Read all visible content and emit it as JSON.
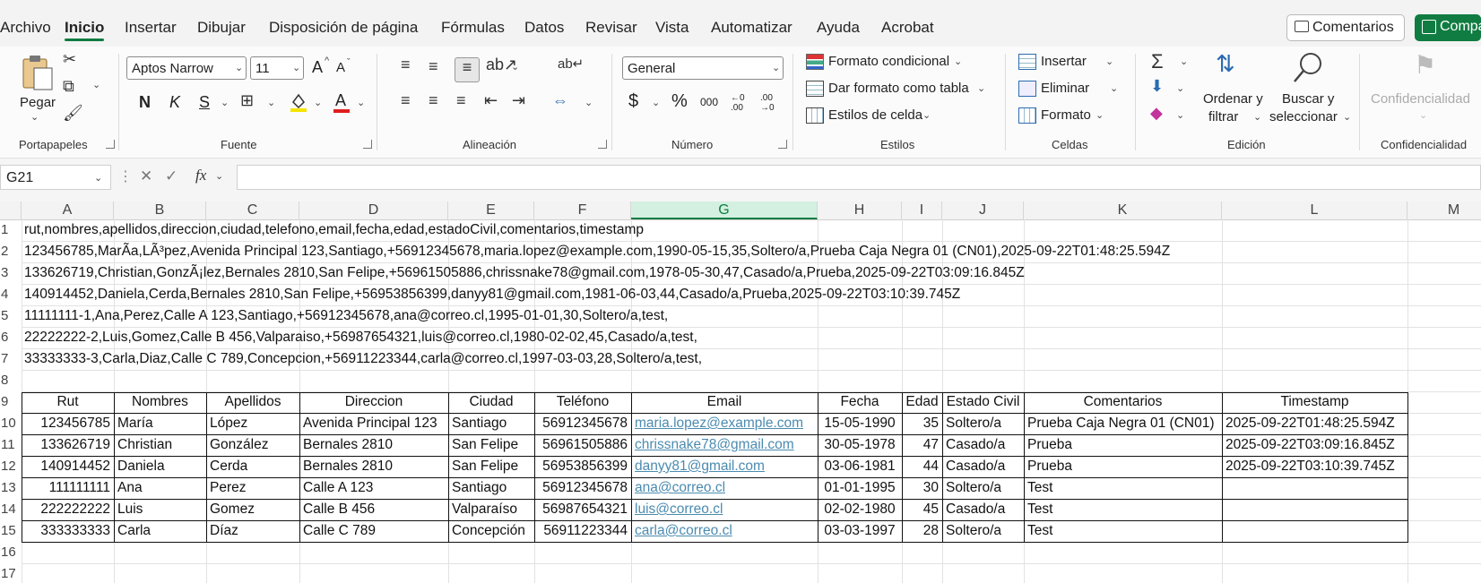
{
  "menu": {
    "tabs": [
      "Archivo",
      "Inicio",
      "Insertar",
      "Dibujar",
      "Disposición de página",
      "Fórmulas",
      "Datos",
      "Revisar",
      "Vista",
      "Automatizar",
      "Ayuda",
      "Acrobat"
    ],
    "comments_label": "Comentarios",
    "share_label": "Compartir"
  },
  "ribbon": {
    "portapapeles": {
      "label": "Portapapeles",
      "paste": "Pegar"
    },
    "fuente": {
      "label": "Fuente",
      "font_name": "Aptos Narrow",
      "font_size": "11",
      "bold": "N",
      "italic": "K",
      "underline": "S",
      "grow": "A",
      "shrink": "A"
    },
    "alineacion": {
      "label": "Alineación"
    },
    "numero": {
      "label": "Número",
      "format": "General",
      "currency": "$",
      "percent": "%",
      "thousands": "000",
      "inc_decimal": "←0 .00",
      "dec_decimal": ".00 →0"
    },
    "estilos": {
      "label": "Estilos",
      "conditional": "Formato condicional",
      "as_table": "Dar formato como tabla",
      "cell_styles": "Estilos de celda"
    },
    "celdas": {
      "label": "Celdas",
      "insert": "Insertar",
      "delete": "Eliminar",
      "format": "Formato"
    },
    "edicion": {
      "label": "Edición",
      "sort_l1": "Ordenar y",
      "sort_l2": "filtrar",
      "find_l1": "Buscar y",
      "find_l2": "seleccionar"
    },
    "confidencialidad": {
      "label": "Confidencialidad",
      "button": "Confidencialidad"
    }
  },
  "formula_bar": {
    "name_box": "G21",
    "fx": "fx",
    "formula": ""
  },
  "grid": {
    "columns": [
      "A",
      "B",
      "C",
      "D",
      "E",
      "F",
      "G",
      "H",
      "I",
      "J",
      "K",
      "L",
      "M"
    ],
    "rows": [
      "1",
      "2",
      "3",
      "4",
      "5",
      "6",
      "7",
      "8",
      "9",
      "10",
      "11",
      "12",
      "13",
      "14",
      "15",
      "16",
      "17"
    ],
    "csv_lines": [
      "rut,nombres,apellidos,direccion,ciudad,telefono,email,fecha,edad,estadoCivil,comentarios,timestamp",
      "123456785,MarÃ­a,LÃ³pez,Avenida Principal 123,Santiago,+56912345678,maria.lopez@example.com,1990-05-15,35,Soltero/a,Prueba Caja Negra 01 (CN01),2025-09-22T01:48:25.594Z",
      "133626719,Christian,GonzÃ¡lez,Bernales 2810,San Felipe,+56961505886,chrissnake78@gmail.com,1978-05-30,47,Casado/a,Prueba,2025-09-22T03:09:16.845Z",
      "140914452,Daniela,Cerda,Bernales 2810,San Felipe,+56953856399,danyy81@gmail.com,1981-06-03,44,Casado/a,Prueba,2025-09-22T03:10:39.745Z",
      "11111111-1,Ana,Perez,Calle A 123,Santiago,+56912345678,ana@correo.cl,1995-01-01,30,Soltero/a,test,",
      "22222222-2,Luis,Gomez,Calle B 456,Valparaiso,+56987654321,luis@correo.cl,1980-02-02,45,Casado/a,test,",
      "33333333-3,Carla,Diaz,Calle C 789,Concepcion,+56911223344,carla@correo.cl,1997-03-03,28,Soltero/a,test,"
    ],
    "table": {
      "headers": [
        "Rut",
        "Nombres",
        "Apellidos",
        "Direccion",
        "Ciudad",
        "Teléfono",
        "Email",
        "Fecha",
        "Edad",
        "Estado Civil",
        "Comentarios",
        "Timestamp"
      ],
      "rows": [
        [
          "123456785",
          "María",
          "López",
          "Avenida Principal 123",
          "Santiago",
          "56912345678",
          "maria.lopez@example.com",
          "15-05-1990",
          "35",
          "Soltero/a",
          "Prueba Caja Negra 01 (CN01)",
          "2025-09-22T01:48:25.594Z"
        ],
        [
          "133626719",
          "Christian",
          "González",
          "Bernales 2810",
          "San Felipe",
          "56961505886",
          "chrissnake78@gmail.com",
          "30-05-1978",
          "47",
          "Casado/a",
          "Prueba",
          "2025-09-22T03:09:16.845Z"
        ],
        [
          "140914452",
          "Daniela",
          "Cerda",
          "Bernales 2810",
          "San Felipe",
          "56953856399",
          "danyy81@gmail.com",
          "03-06-1981",
          "44",
          "Casado/a",
          "Prueba",
          "2025-09-22T03:10:39.745Z"
        ],
        [
          "111111111",
          "Ana",
          "Perez",
          "Calle A 123",
          "Santiago",
          "56912345678",
          "ana@correo.cl",
          "01-01-1995",
          "30",
          "Soltero/a",
          "Test",
          ""
        ],
        [
          "222222222",
          "Luis",
          "Gomez",
          "Calle B 456",
          "Valparaíso",
          "56987654321",
          "luis@correo.cl",
          "02-02-1980",
          "45",
          "Casado/a",
          "Test",
          ""
        ],
        [
          "333333333",
          "Carla",
          "Díaz",
          "Calle C 789",
          "Concepción",
          "56911223344",
          "carla@correo.cl",
          "03-03-1997",
          "28",
          "Soltero/a",
          "Test",
          ""
        ]
      ]
    },
    "selected_column": "G",
    "accent_color": "#107c41",
    "link_color": "#4b8bb0"
  }
}
